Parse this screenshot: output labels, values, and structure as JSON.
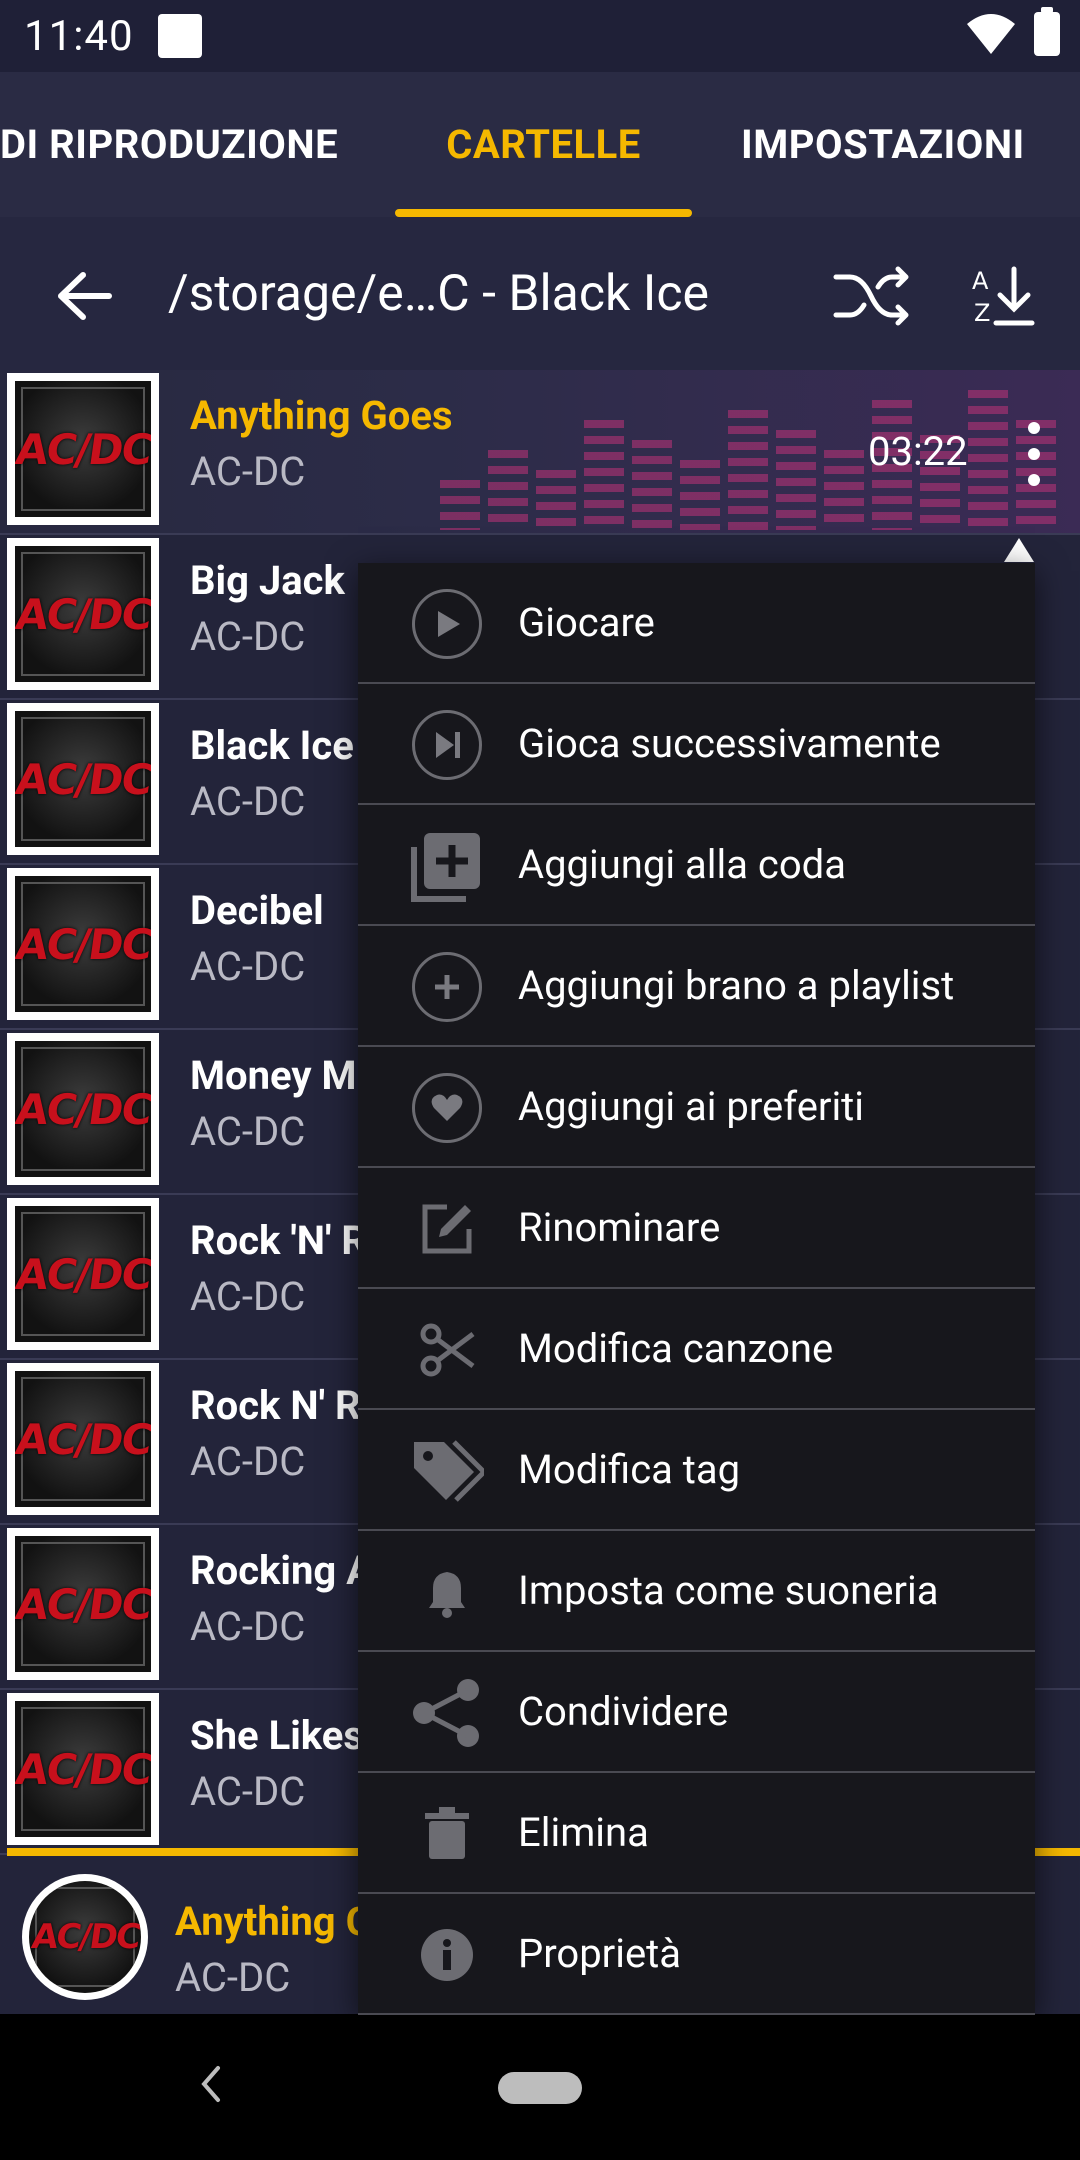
{
  "status_bar": {
    "time": "11:40"
  },
  "tabs": [
    {
      "label": "DI RIPRODUZIONE"
    },
    {
      "label": "CARTELLE"
    },
    {
      "label": "IMPOSTAZIONI"
    }
  ],
  "toolbar": {
    "path": "/storage/e…C - Black Ice"
  },
  "songs": [
    {
      "title": "Anything Goes",
      "artist": "AC-DC",
      "duration": "03:22"
    },
    {
      "title": "Big Jack",
      "artist": "AC-DC"
    },
    {
      "title": "Black Ice",
      "artist": "AC-DC"
    },
    {
      "title": "Decibel",
      "artist": "AC-DC"
    },
    {
      "title": "Money M",
      "artist": "AC-DC"
    },
    {
      "title": "Rock 'N' R",
      "artist": "AC-DC"
    },
    {
      "title": "Rock N' R",
      "artist": "AC-DC"
    },
    {
      "title": "Rocking A",
      "artist": "AC-DC"
    },
    {
      "title": "She Likes",
      "artist": "AC-DC"
    }
  ],
  "cover_text": "AC/DC",
  "now_playing": {
    "title": "Anything G",
    "artist": "AC-DC"
  },
  "menu": [
    {
      "label": "Giocare",
      "icon": "play-icon"
    },
    {
      "label": "Gioca successivamente",
      "icon": "play-next-icon"
    },
    {
      "label": "Aggiungi alla coda",
      "icon": "add-queue-icon"
    },
    {
      "label": "Aggiungi brano a playlist",
      "icon": "add-playlist-icon"
    },
    {
      "label": "Aggiungi ai preferiti",
      "icon": "heart-icon"
    },
    {
      "label": "Rinominare",
      "icon": "edit-icon"
    },
    {
      "label": "Modifica canzone",
      "icon": "scissors-icon"
    },
    {
      "label": "Modifica tag",
      "icon": "tag-icon"
    },
    {
      "label": "Imposta come suoneria",
      "icon": "bell-icon"
    },
    {
      "label": "Condividere",
      "icon": "share-icon"
    },
    {
      "label": "Elimina",
      "icon": "trash-icon"
    },
    {
      "label": "Proprietà",
      "icon": "info-icon"
    }
  ],
  "colors": {
    "accent": "#f5b800",
    "background": "#23243a",
    "menu_bg": "#17171c"
  }
}
